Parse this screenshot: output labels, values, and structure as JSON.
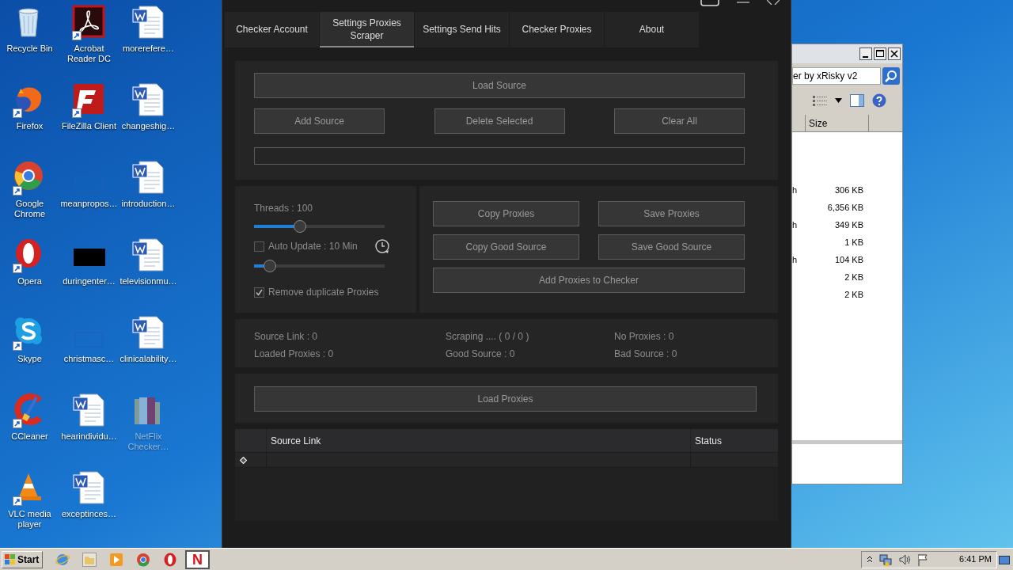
{
  "desktop_icons": [
    {
      "label": "Recycle Bin",
      "kind": "recycle",
      "shortcut": false,
      "dimmed": false
    },
    {
      "label": "Firefox",
      "kind": "firefox",
      "shortcut": true,
      "dimmed": false
    },
    {
      "label": "Google Chrome",
      "kind": "chrome",
      "shortcut": true,
      "dimmed": false
    },
    {
      "label": "Opera",
      "kind": "opera",
      "shortcut": true,
      "dimmed": false
    },
    {
      "label": "Skype",
      "kind": "skype",
      "shortcut": true,
      "dimmed": false
    },
    {
      "label": "CCleaner",
      "kind": "ccleaner",
      "shortcut": true,
      "dimmed": false
    },
    {
      "label": "VLC media player",
      "kind": "vlc",
      "shortcut": true,
      "dimmed": false
    },
    {
      "label": "Acrobat Reader DC",
      "kind": "acrobat",
      "shortcut": true,
      "dimmed": false
    },
    {
      "label": "FileZilla Client",
      "kind": "filezilla",
      "shortcut": true,
      "dimmed": false
    },
    {
      "label": "meanpropos…",
      "kind": "blank",
      "shortcut": false,
      "dimmed": false
    },
    {
      "label": "duringenter…",
      "kind": "black",
      "shortcut": false,
      "dimmed": false
    },
    {
      "label": "christmasc…",
      "kind": "blank",
      "shortcut": false,
      "dimmed": false
    },
    {
      "label": "hearindividu…",
      "kind": "word",
      "shortcut": false,
      "dimmed": false
    },
    {
      "label": "exceptinces…",
      "kind": "word",
      "shortcut": false,
      "dimmed": false
    },
    {
      "label": "morerefere…",
      "kind": "word",
      "shortcut": false,
      "dimmed": false
    },
    {
      "label": "changeshig…",
      "kind": "word",
      "shortcut": false,
      "dimmed": false
    },
    {
      "label": "introduction…",
      "kind": "word",
      "shortcut": false,
      "dimmed": false
    },
    {
      "label": "televisionmu…",
      "kind": "word",
      "shortcut": false,
      "dimmed": false
    },
    {
      "label": "clinicalability…",
      "kind": "word",
      "shortcut": false,
      "dimmed": false
    },
    {
      "label": "NetFlix Checker…",
      "kind": "folder",
      "shortcut": false,
      "dimmed": true
    }
  ],
  "app": {
    "tabs": [
      {
        "label": "Checker Account",
        "selected": false
      },
      {
        "label": "Settings Proxies Scraper",
        "selected": true
      },
      {
        "label": "Settings Send Hits",
        "selected": false
      },
      {
        "label": "Checker Proxies",
        "selected": false
      },
      {
        "label": "About",
        "selected": false
      }
    ],
    "load_source_button": "Load Source",
    "source_buttons": [
      "Add Source",
      "Delete Selected",
      "Clear All"
    ],
    "threads": {
      "label": "Threads : 100",
      "level": 0.35
    },
    "auto_update": {
      "label": "Auto Update : 10 Min",
      "checked": false,
      "level": 0.12
    },
    "remove_duplicates": {
      "label": "Remove duplicate Proxies",
      "checked": true
    },
    "action_buttons": [
      {
        "label": "Copy Proxies",
        "kind": "half"
      },
      {
        "label": "Save Proxies",
        "kind": "half"
      },
      {
        "label": "Copy Good Source",
        "kind": "half"
      },
      {
        "label": "Save Good Source",
        "kind": "half"
      },
      {
        "label": "Add Proxies to Checker",
        "kind": "wide"
      }
    ],
    "stats": [
      "Source Link : 0",
      "Scraping .... ( 0 / 0 )",
      "No Proxies : 0",
      "Loaded Proxies : 0",
      "Good Source : 0",
      "Bad Source : 0"
    ],
    "load_proxies_button": "Load Proxies",
    "table": {
      "columns": [
        "Source Link",
        "Status"
      ]
    }
  },
  "explorer": {
    "search_value": "er by xRisky v2",
    "column": "Size",
    "rows": [
      {
        "column_1": "h",
        "size": "306 KB"
      },
      {
        "column_1": "",
        "size": "6,356 KB"
      },
      {
        "column_1": "h",
        "size": "349 KB"
      },
      {
        "column_1": "",
        "size": "1 KB"
      },
      {
        "column_1": "h",
        "size": "104 KB"
      },
      {
        "column_1": "",
        "size": "2 KB"
      },
      {
        "column_1": "",
        "size": "2 KB"
      }
    ]
  },
  "taskbar": {
    "start": "Start",
    "quick_launch": [
      {
        "kind": "ie"
      },
      {
        "kind": "explorer"
      },
      {
        "kind": "media"
      },
      {
        "kind": "chrome"
      },
      {
        "kind": "opera"
      }
    ],
    "active_app": "N",
    "clock": "6:41 PM"
  }
}
